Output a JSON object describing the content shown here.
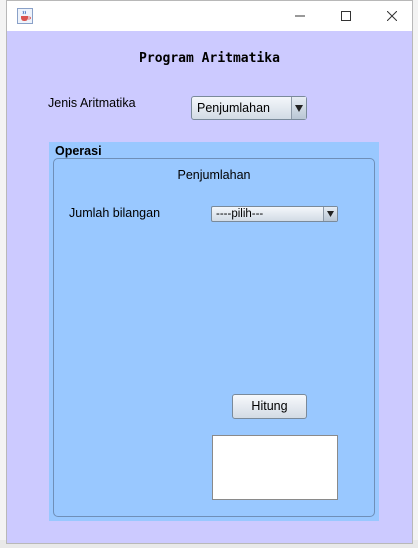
{
  "window": {
    "title": "Program Aritmatika"
  },
  "form": {
    "jenis_label": "Jenis Aritmatika",
    "jenis_selected": "Penjumlahan"
  },
  "panel": {
    "title": "Operasi",
    "subtitle": "Penjumlahan",
    "jumlah_label": "Jumlah bilangan",
    "jumlah_selected": "----pilih---",
    "hitung_label": "Hitung",
    "result_value": ""
  },
  "icons": {
    "app": "java-cup-icon",
    "minimize": "minimize-icon",
    "maximize": "maximize-icon",
    "close": "close-icon",
    "dropdown": "triangle-down-icon"
  },
  "colors": {
    "window_bg": "#cccaff",
    "panel_bg": "#99c8ff"
  }
}
